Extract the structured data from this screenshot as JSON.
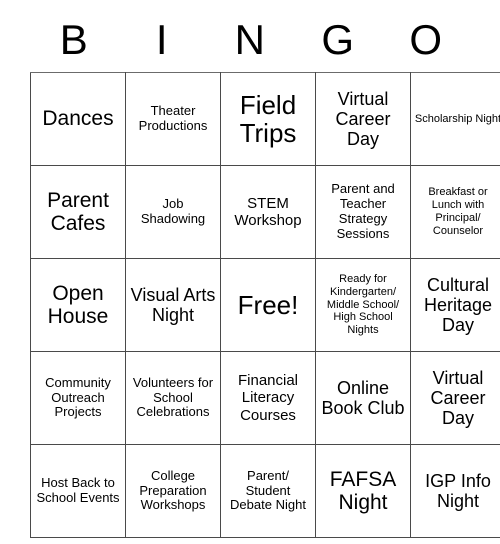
{
  "card": {
    "header_letters": [
      "B",
      "I",
      "N",
      "G",
      "O"
    ],
    "rows": [
      [
        {
          "text": "Dances",
          "size": "fs-xl"
        },
        {
          "text": "Theater Productions",
          "size": "fs-s"
        },
        {
          "text": "Field Trips",
          "size": "fs-xxl"
        },
        {
          "text": "Virtual Career Day",
          "size": "fs-l"
        },
        {
          "text": "Scholarship Night",
          "size": "fs-xs"
        }
      ],
      [
        {
          "text": "Parent Cafes",
          "size": "fs-xl"
        },
        {
          "text": "Job Shadowing",
          "size": "fs-s"
        },
        {
          "text": "STEM Workshop",
          "size": "fs-m"
        },
        {
          "text": "Parent and Teacher Strategy Sessions",
          "size": "fs-s"
        },
        {
          "text": "Breakfast or Lunch with Principal/ Counselor",
          "size": "fs-xs"
        }
      ],
      [
        {
          "text": "Open House",
          "size": "fs-xl"
        },
        {
          "text": "Visual Arts Night",
          "size": "fs-l"
        },
        {
          "text": "Free!",
          "size": "fs-xxl"
        },
        {
          "text": "Ready for Kindergarten/ Middle School/ High School Nights",
          "size": "fs-xs"
        },
        {
          "text": "Cultural Heritage Day",
          "size": "fs-l"
        }
      ],
      [
        {
          "text": "Community Outreach Projects",
          "size": "fs-s"
        },
        {
          "text": "Volunteers for School Celebrations",
          "size": "fs-s"
        },
        {
          "text": "Financial Literacy Courses",
          "size": "fs-m"
        },
        {
          "text": "Online Book Club",
          "size": "fs-l"
        },
        {
          "text": "Virtual Career Day",
          "size": "fs-l"
        }
      ],
      [
        {
          "text": "Host Back to School Events",
          "size": "fs-s"
        },
        {
          "text": "College Preparation Workshops",
          "size": "fs-s"
        },
        {
          "text": "Parent/ Student Debate Night",
          "size": "fs-s"
        },
        {
          "text": "FAFSA Night",
          "size": "fs-xl"
        },
        {
          "text": "IGP Info Night",
          "size": "fs-l"
        }
      ]
    ]
  }
}
